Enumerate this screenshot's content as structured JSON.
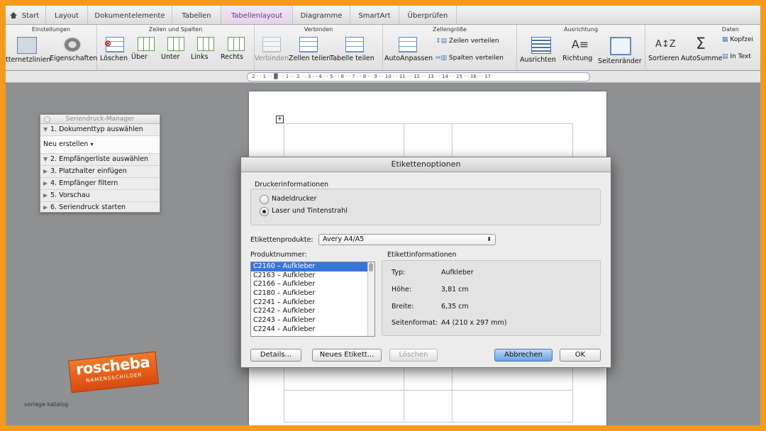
{
  "colors": {
    "frame_border": "#f49a1c",
    "accent_tab": "#7a2e9a",
    "selection": "#3a75d8"
  },
  "tabs": [
    {
      "label": "Start",
      "icon": "home-icon"
    },
    {
      "label": "Layout"
    },
    {
      "label": "Dokumentelemente"
    },
    {
      "label": "Tabellen"
    },
    {
      "label": "Tabellenlayout",
      "active": true
    },
    {
      "label": "Diagramme"
    },
    {
      "label": "SmartArt"
    },
    {
      "label": "Überprüfen"
    }
  ],
  "ribbon": {
    "groups": [
      "Einstellungen",
      "Zeilen und Spalten",
      "Verbinden",
      "Zellengröße",
      "Ausrichtung",
      "Daten"
    ],
    "buttons": {
      "gitternetzlinien": "tternetzlinien",
      "eigenschaften": "Eigenschaften",
      "loeschen": "Löschen",
      "ueber": "Über",
      "unter": "Unter",
      "links": "Links",
      "rechts": "Rechts",
      "verbinden": "Verbinden",
      "zellen_teilen": "Zellen teilen",
      "tabelle_teilen": "Tabelle teilen",
      "autoanpassen": "AutoAnpassen",
      "zeilen_verteilen": "Zeilen verteilen",
      "spalten_verteilen": "Spalten verteilen",
      "ausrichten": "Ausrichten",
      "richtung": "Richtung",
      "seitenraender": "Seitenränder",
      "sortieren": "Sortieren",
      "autosumme": "AutoSumme",
      "kopfzeile": "Kopfzei",
      "in_text": "In Text"
    }
  },
  "ruler": {
    "text": "2 · · 1 · · ▓ · · 1 · · 2 · · 3 · · 4 · · 5 · · 6 · · 7 · · 8 · · 9 · · 10 · · 11 · · 12 · · 13 · · 14 · · 15 · · 16 · · 17"
  },
  "mail_merge": {
    "title": "Seriendruck-Manager",
    "step1": "1. Dokumenttyp auswählen",
    "step1_sub": "Neu erstellen",
    "step2": "2. Empfängerliste auswählen",
    "step3": "3. Platzhalter einfügen",
    "step4": "4. Empfänger filtern",
    "step5": "5. Vorschau",
    "step6": "6. Seriendruck starten"
  },
  "logo": {
    "line1": "roscheba",
    "line2": "NAMENSSCHILDER"
  },
  "caption": "vorlage katalog",
  "dialog": {
    "title": "Etikettenoptionen",
    "printer_section": "Druckerinformationen",
    "radio_dot": "Nadeldrucker",
    "radio_laser": "Laser und Tintenstrahl",
    "products_label": "Etikettenprodukte:",
    "products_value": "Avery A4/A5",
    "product_number_label": "Produktnummer:",
    "products": [
      "C2160 – Aufkleber",
      "C2163 – Aufkleber",
      "C2166 – Aufkleber",
      "C2180 – Aufkleber",
      "C2241 – Aufkleber",
      "C2242 – Aufkleber",
      "C2243 – Aufkleber",
      "C2244 – Aufkleber"
    ],
    "info_title": "Etikettinformationen",
    "info": {
      "typ_label": "Typ:",
      "typ_value": "Aufkleber",
      "hoehe_label": "Höhe:",
      "hoehe_value": "3,81 cm",
      "breite_label": "Breite:",
      "breite_value": "6,35 cm",
      "format_label": "Seitenformat:",
      "format_value": "A4 (210 x 297 mm)"
    },
    "buttons": {
      "details": "Details...",
      "new_label": "Neues Etikett...",
      "delete": "Löschen",
      "cancel": "Abbrechen",
      "ok": "OK"
    }
  }
}
